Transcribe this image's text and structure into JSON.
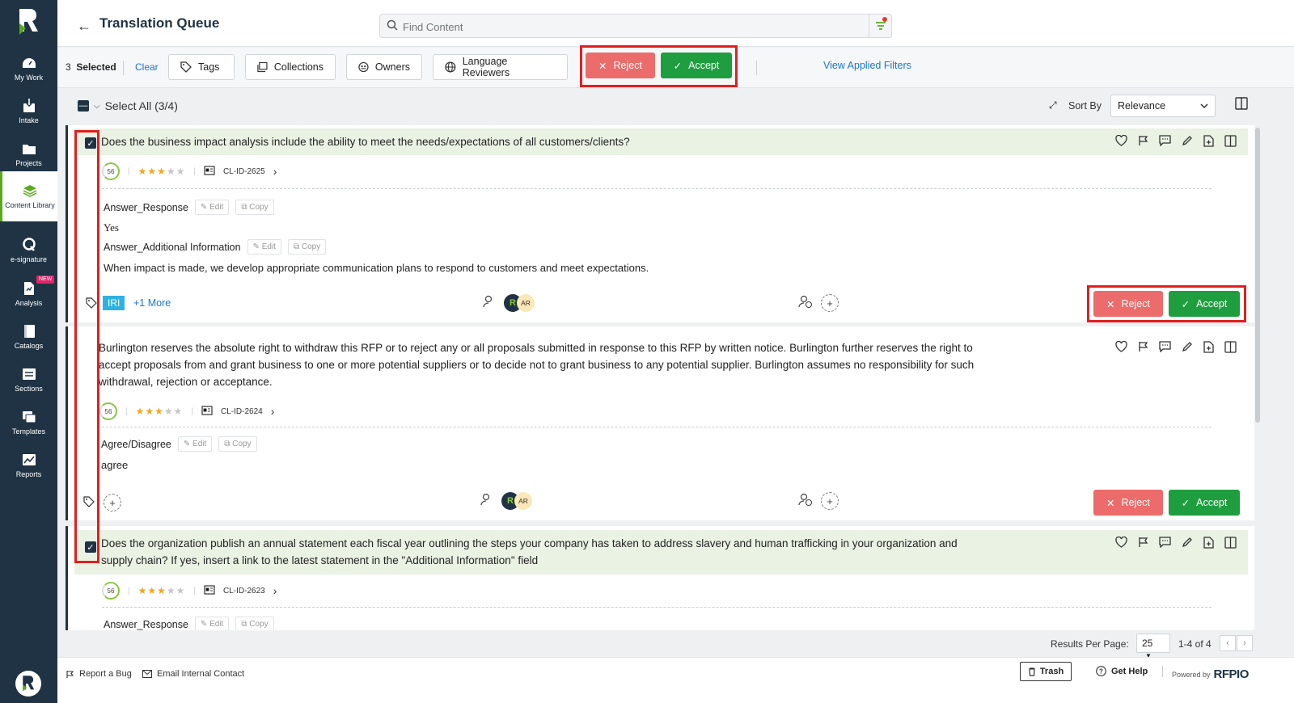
{
  "page": {
    "title": "Translation Queue",
    "search_placeholder": "Find Content"
  },
  "sidebar": {
    "items": [
      {
        "label": "My Work",
        "icon": "gauge-icon"
      },
      {
        "label": "Intake",
        "icon": "intake-icon"
      },
      {
        "label": "Projects",
        "icon": "projects-icon"
      },
      {
        "label": "Content Library",
        "icon": "library-icon",
        "active": true
      },
      {
        "label": "e-signature",
        "icon": "esignature-icon"
      },
      {
        "label": "Analysis",
        "icon": "analysis-icon",
        "badge": "NEW"
      },
      {
        "label": "Catalogs",
        "icon": "catalogs-icon"
      },
      {
        "label": "Sections",
        "icon": "sections-icon"
      },
      {
        "label": "Templates",
        "icon": "templates-icon"
      },
      {
        "label": "Reports",
        "icon": "reports-icon"
      }
    ]
  },
  "actionbar": {
    "selected_count": "3",
    "selected_label": "Selected",
    "clear": "Clear",
    "tags": "Tags",
    "collections": "Collections",
    "owners": "Owners",
    "language_reviewers": "Language Reviewers",
    "reject": "Reject",
    "accept": "Accept",
    "view_filters": "View Applied Filters"
  },
  "listhead": {
    "select_all": "Select All (3/4)",
    "sort_by": "Sort By",
    "sort_value": "Relevance"
  },
  "cards": [
    {
      "question": "Does the business impact analysis include the ability to meet the needs/expectations of all customers/clients?",
      "checked": true,
      "score": "56",
      "rating": 3,
      "id": "CL-ID-2625",
      "fields": [
        {
          "label": "Answer_Response",
          "value": "Yes"
        },
        {
          "label": "Answer_Additional Information",
          "value": "When impact is made, we develop appropriate communication plans to respond to customers and meet expectations."
        }
      ],
      "tag": "IRI",
      "more": "+1 More",
      "avatar": "AR"
    },
    {
      "question_lines": [
        "Burlington reserves the absolute right to withdraw this RFP or to reject any or all proposals submitted in response to this RFP by written notice. Burlington further reserves the right to",
        "accept proposals from and grant business to one or more potential suppliers or to decide not to grant business to any potential supplier. Burlington assumes no responsibility for such",
        "withdrawal, rejection or acceptance."
      ],
      "checked": false,
      "score": "56",
      "rating": 3,
      "id": "CL-ID-2624",
      "fields": [
        {
          "label": "Agree/Disagree",
          "value": "agree"
        }
      ],
      "avatar": "AR"
    },
    {
      "question_lines": [
        "Does the organization publish an annual statement each fiscal year outlining the steps your company has taken to address slavery and human trafficking in your organization and",
        "supply chain? If yes, insert a link to the latest statement in the \"Additional Information\" field"
      ],
      "checked": true,
      "score": "56",
      "rating": 3,
      "id": "CL-ID-2623",
      "fields": [
        {
          "label": "Answer_Response"
        }
      ]
    }
  ],
  "buttons": {
    "edit": "Edit",
    "copy": "Copy",
    "reject": "Reject",
    "accept": "Accept"
  },
  "pager": {
    "results_per_page_label": "Results Per Page:",
    "per_page": "25",
    "range": "1-4 of 4"
  },
  "footer": {
    "report_bug": "Report a Bug",
    "email_contact": "Email Internal Contact",
    "trash": "Trash",
    "get_help": "Get Help",
    "powered_by": "Powered by",
    "brand": "RFPIO"
  },
  "colors": {
    "sidebar": "#1f3344",
    "accept": "#1e9e3e",
    "reject": "#ec6b6b",
    "highlight": "#e11f1f",
    "question_band": "#e9f2e3",
    "link": "#1976d2"
  }
}
